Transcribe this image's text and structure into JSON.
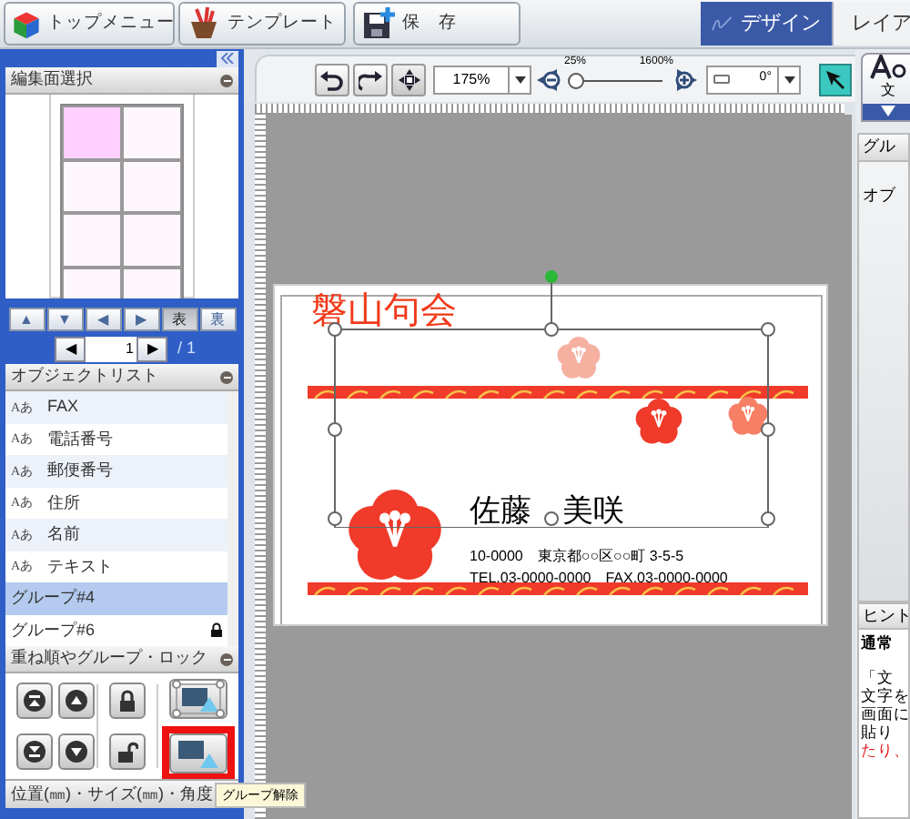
{
  "top_buttons": [
    {
      "kind": "cube",
      "label": "トップメニュー"
    },
    {
      "kind": "basket",
      "label": "テンプレート"
    },
    {
      "kind": "save",
      "label": "保　存"
    }
  ],
  "mode_tabs": [
    {
      "label": "デザイン",
      "selected": true
    },
    {
      "label": "レイア",
      "selected": false
    }
  ],
  "page_select": {
    "title": "編集面選択",
    "cells": [
      {
        "selected": true
      },
      {
        "selected": false
      },
      {
        "selected": false
      },
      {
        "selected": false
      },
      {
        "selected": false
      },
      {
        "selected": false
      },
      {
        "selected": false
      },
      {
        "selected": false
      }
    ]
  },
  "nav_buttons": [
    {
      "label": "▲",
      "selected": false
    },
    {
      "label": "▼",
      "selected": false
    },
    {
      "label": "◀",
      "selected": false
    },
    {
      "label": "▶",
      "selected": false
    },
    {
      "label": "表",
      "selected": true
    },
    {
      "label": "裏",
      "selected": false
    }
  ],
  "pager": {
    "prev": "◀",
    "page": "1",
    "next": "▶",
    "total": "/ 1"
  },
  "object_list": {
    "title": "オブジェクトリスト",
    "items": [
      {
        "kind": "text",
        "icon": "Aあ",
        "label": "FAX",
        "selected": false,
        "locked": false
      },
      {
        "kind": "text",
        "icon": "Aあ",
        "label": "電話番号",
        "selected": false,
        "locked": false
      },
      {
        "kind": "text",
        "icon": "Aあ",
        "label": "郵便番号",
        "selected": false,
        "locked": false
      },
      {
        "kind": "text",
        "icon": "Aあ",
        "label": "住所",
        "selected": false,
        "locked": false
      },
      {
        "kind": "text",
        "icon": "Aあ",
        "label": "名前",
        "selected": false,
        "locked": false
      },
      {
        "kind": "text",
        "icon": "Aあ",
        "label": "テキスト",
        "selected": false,
        "locked": false
      },
      {
        "kind": "group",
        "label": "グループ#4",
        "selected": true,
        "locked": false
      },
      {
        "kind": "group",
        "label": "グループ#6",
        "selected": false,
        "locked": true
      }
    ]
  },
  "arrange": {
    "title": "重ね順やグループ・ロック",
    "buttons": [
      {
        "kind": "to_front",
        "highlighted": false
      },
      {
        "kind": "forward",
        "highlighted": false
      },
      {
        "kind": "lock",
        "highlighted": false
      },
      {
        "kind": "group",
        "highlighted": false
      },
      {
        "kind": "to_back",
        "highlighted": false
      },
      {
        "kind": "backward",
        "highlighted": false
      },
      {
        "kind": "unlock",
        "highlighted": false
      },
      {
        "kind": "ungroup",
        "highlighted": true
      }
    ]
  },
  "position_section": {
    "title": "位置(㎜)・サイズ(㎜)・角度"
  },
  "tooltip": "グループ解除",
  "toolbar": {
    "zoom": "175%",
    "zoom_min": "25%",
    "zoom_max": "1600%",
    "level": 0.03,
    "rotation": "0°"
  },
  "card": {
    "title": "磐山句会",
    "name": "佐藤　美咲",
    "address": "10-0000　東京都○○区○○町 3-5-5",
    "contact": "TEL.03-0000-0000　FAX.03-0000-0000"
  },
  "right_panel": {
    "button_label": "文",
    "group_title": "グル",
    "group_text": "オブ",
    "hint_title": "ヒント",
    "hint_lines": [
      {
        "kind": "heading",
        "text": "通常",
        "color": "#000000"
      },
      {
        "kind": "gap",
        "text": "「文",
        "color": "#000000"
      },
      {
        "kind": "body",
        "text": "文字を",
        "color": "#000000"
      },
      {
        "kind": "body",
        "text": "画面に",
        "color": "#000000"
      },
      {
        "kind": "body",
        "text": "貼り",
        "color": "#000000"
      },
      {
        "kind": "body",
        "text": "たり、",
        "color": "#e02020"
      }
    ]
  }
}
